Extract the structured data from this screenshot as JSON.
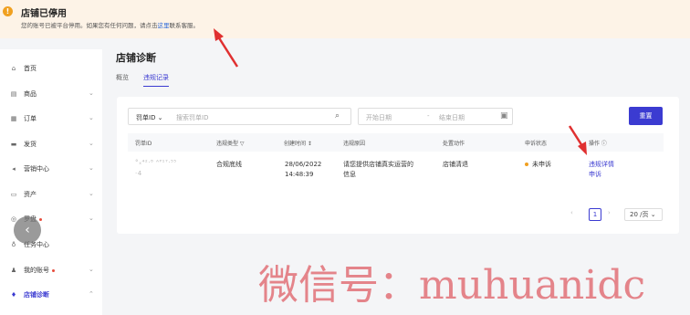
{
  "banner": {
    "icon": "exclamation-icon",
    "title": "店铺已停用",
    "text_before": "您的账号已被平台停用。如果您有任何问题，请点击",
    "link": "这里",
    "text_after": "联系客服。"
  },
  "sidebar": {
    "items": [
      {
        "name": "home",
        "icon": "home-icon",
        "glyph": "⌂",
        "label": "首页",
        "chevron": "",
        "dot": false
      },
      {
        "name": "products",
        "icon": "product-icon",
        "glyph": "▤",
        "label": "商品",
        "chevron": "⌄",
        "dot": false
      },
      {
        "name": "orders",
        "icon": "order-icon",
        "glyph": "▦",
        "label": "订单",
        "chevron": "⌄",
        "dot": false
      },
      {
        "name": "shipping",
        "icon": "truck-icon",
        "glyph": "▬",
        "label": "发货",
        "chevron": "⌄",
        "dot": false
      },
      {
        "name": "marketing",
        "icon": "megaphone-icon",
        "glyph": "◂",
        "label": "营销中心",
        "chevron": "⌄",
        "dot": false
      },
      {
        "name": "assets",
        "icon": "wallet-icon",
        "glyph": "▭",
        "label": "资产",
        "chevron": "⌄",
        "dot": false
      },
      {
        "name": "compass",
        "icon": "compass-icon",
        "glyph": "◎",
        "label": "罗盘",
        "chevron": "⌄",
        "dot": true
      },
      {
        "name": "tasks",
        "icon": "task-icon",
        "glyph": "♁",
        "label": "任务中心",
        "chevron": "",
        "dot": false
      },
      {
        "name": "account",
        "icon": "user-icon",
        "glyph": "♟",
        "label": "我的账号",
        "chevron": "⌄",
        "dot": true
      },
      {
        "name": "shop-diagnosis",
        "icon": "diagnosis-icon",
        "glyph": "♦",
        "label": "店铺诊断",
        "chevron": "⌃",
        "dot": false
      }
    ],
    "collapse_glyph": "‹"
  },
  "main": {
    "title": "店铺诊断",
    "tabs": [
      {
        "label": "概览"
      },
      {
        "label": "违规记录",
        "active": true
      }
    ]
  },
  "filters": {
    "select_label": "罚单ID ⌄",
    "search_placeholder": "搜索罚单ID",
    "search_icon": "search-icon",
    "date_start": "开始日期",
    "date_sep": "-",
    "date_end": "结束日期",
    "calendar_icon": "calendar-icon",
    "reset_label": "重置"
  },
  "table": {
    "headers": [
      "罚单ID",
      "违规类型 ▽",
      "创建时间 ↕",
      "违规原因",
      "处置动作",
      "申诉状态",
      "操作 ⓘ"
    ],
    "rows": [
      {
        "id_line1": "°ₓ⁴²·⁸ ᴬᴾ¹⁷·⁵⁵",
        "id_line2": "·4",
        "type": "合规底线",
        "date": "28/06/2022",
        "time": "14:48:39",
        "reason_line1": "请您提供店铺真实运营的",
        "reason_line2": "信息",
        "action": "店铺清退",
        "status": "未申诉",
        "op1": "违规详情",
        "op2": "申诉"
      }
    ]
  },
  "pagination": {
    "prev": "‹",
    "page": "1",
    "next": "›",
    "page_size": "20 /页 ⌄"
  },
  "colors": {
    "accent": "#3b3bd1",
    "warning": "#f0a020",
    "banner_bg": "#fdf3e7",
    "annotation_arrow": "#e03030"
  },
  "watermark": "微信号：muhuanidc"
}
